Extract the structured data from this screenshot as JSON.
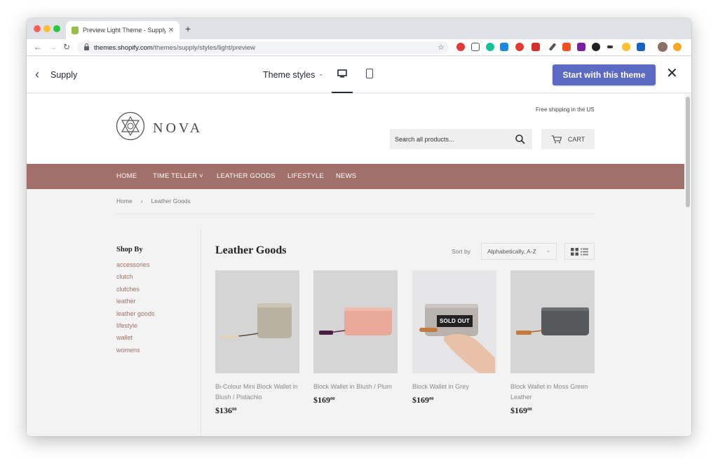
{
  "browser": {
    "tab": {
      "title": "Preview Light Theme - Supply",
      "close": "✕"
    },
    "newtab": "+",
    "nav": {
      "back": "←",
      "forward": "→",
      "reload": "↻"
    },
    "url": {
      "host": "themes.shopify.com",
      "path": "/themes/supply/styles/light/preview"
    },
    "bookmark": "☆"
  },
  "preview_bar": {
    "back": "‹",
    "theme_name": "Supply",
    "styles_label": "Theme styles",
    "styles_caret": "⌄",
    "cta_label": "Start with this theme",
    "close": "✕",
    "colors": {
      "cta": "#5c6ac4"
    }
  },
  "store": {
    "logo_text": "NOVA",
    "shipping_note": "Free shipping in the US",
    "search_placeholder": "Search all products...",
    "cart_label": "CART",
    "nav": [
      {
        "label": "HOME"
      },
      {
        "label": "TIME TELLER ˅"
      },
      {
        "label": "LEATHER GOODS"
      },
      {
        "label": "LIFESTYLE"
      },
      {
        "label": "NEWS"
      }
    ],
    "colors": {
      "nav": "#a2706a"
    },
    "breadcrumb": {
      "home": "Home",
      "sep": "›",
      "current": "Leather Goods"
    },
    "sidebar": {
      "title": "Shop By",
      "tags": [
        "accessories",
        "clutch",
        "clutches",
        "leather",
        "leather goods",
        "lifestyle",
        "wallet",
        "womens"
      ]
    },
    "collection": {
      "title": "Leather Goods",
      "sort_label": "Sort by",
      "sort_value": "Alphabetically, A-Z",
      "sort_caret": "⌄"
    },
    "products": [
      {
        "title": "Bi-Colour Mini Block Wallet in Blush / Pistachio",
        "price": "$136",
        "cents": "00"
      },
      {
        "title": "Block Wallet in Blush / Plum",
        "price": "$169",
        "cents": "00"
      },
      {
        "title": "Block Wallet in Grey",
        "price": "$169",
        "cents": "00",
        "badge": "SOLD OUT"
      },
      {
        "title": "Block Wallet in Moss Green Leather",
        "price": "$169",
        "cents": "00"
      }
    ]
  }
}
